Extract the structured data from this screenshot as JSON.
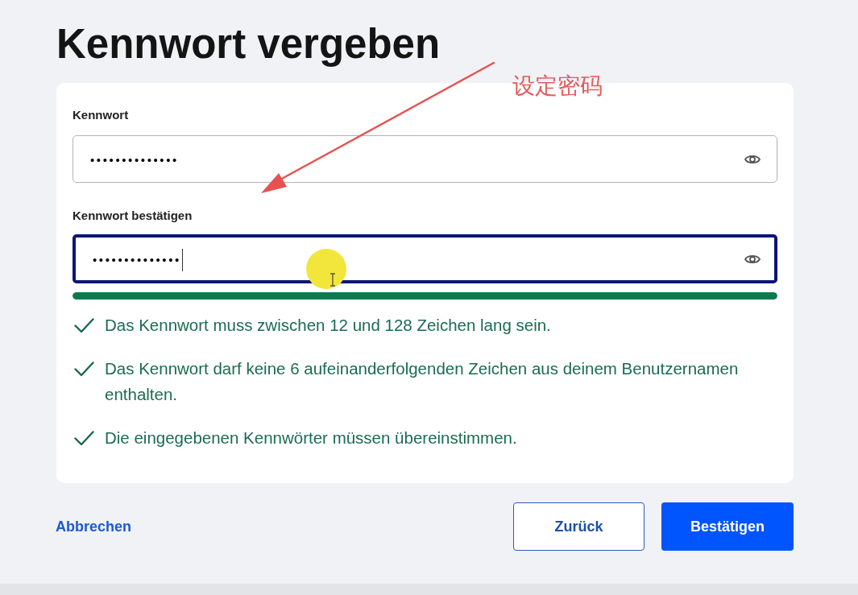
{
  "page": {
    "title": "Kennwort vergeben"
  },
  "fields": [
    {
      "label": "Kennwort",
      "value": "••••••••••••••",
      "focused": false
    },
    {
      "label": "Kennwort bestätigen",
      "value": "••••••••••••••",
      "focused": true
    }
  ],
  "strength_meter": {
    "level": 1
  },
  "requirements": [
    {
      "text": "Das Kennwort muss zwischen 12 und 128 Zeichen lang sein.",
      "met": true
    },
    {
      "text": "Das Kennwort darf keine 6 aufeinanderfolgenden Zeichen aus deinem Benutzernamen enthalten.",
      "met": true
    },
    {
      "text": "Die eingegebenen Kennwörter müssen übereinstimmen.",
      "met": true
    }
  ],
  "actions": {
    "cancel_link": "Abbrechen",
    "buttons": [
      {
        "label": "Zurück",
        "kind": "secondary"
      },
      {
        "label": "Bestätigen",
        "kind": "primary"
      }
    ]
  },
  "annotation": {
    "text": "设定密码"
  }
}
